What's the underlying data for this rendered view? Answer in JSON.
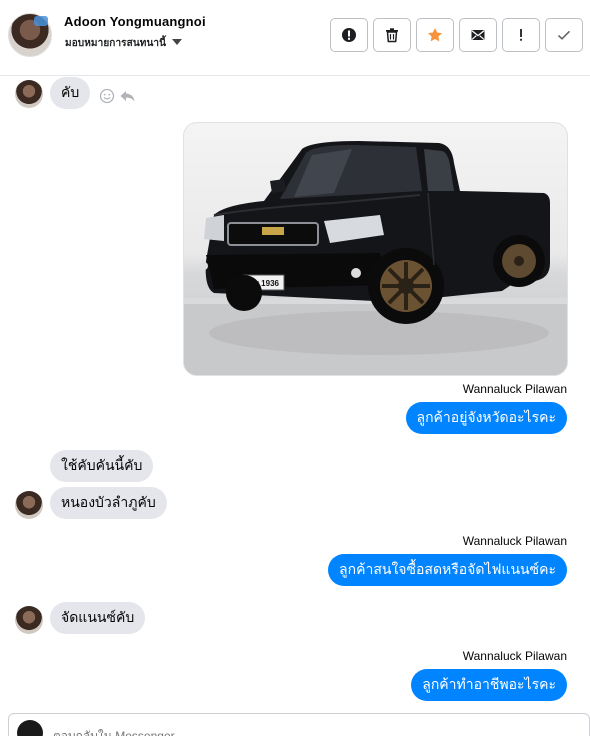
{
  "header": {
    "contact_name": "Adoon Yongmuangnoi",
    "contact_subtitle": "มอบหมายการสนทนานี้",
    "actions": [
      {
        "name": "report-button",
        "icon": "alert-circle-icon"
      },
      {
        "name": "delete-button",
        "icon": "trash-icon"
      },
      {
        "name": "star-button",
        "icon": "star-icon"
      },
      {
        "name": "mark-unread-button",
        "icon": "envelope-icon"
      },
      {
        "name": "follow-up-button",
        "icon": "exclamation-icon"
      },
      {
        "name": "done-button",
        "icon": "checkmark-icon"
      }
    ]
  },
  "messages": {
    "m1": "คับ",
    "m2_sender": "Wannaluck Pilawan",
    "m2": "ลูกค้าอยู่จังหวัดอะไรคะ",
    "m3a": "ใช้คับคันนี้คับ",
    "m3b": "หนองบัวลำภูคับ",
    "m4_sender": "Wannaluck Pilawan",
    "m4": "ลูกค้าสนใจซื้อสดหรือจัดไฟแนนซ์คะ",
    "m5": "จัดแนนซ์คับ",
    "m6_sender": "Wannaluck Pilawan",
    "m6": "ลูกค้าทำอาชีพอะไรคะ"
  },
  "photo": {
    "license_plate": "ผพ 1936"
  },
  "composer": {
    "placeholder": "ตอบกลับใน Messenger"
  },
  "colors": {
    "outgoing_bubble": "#0084ff",
    "incoming_bubble": "#e4e6eb",
    "star": "#f7923b"
  }
}
